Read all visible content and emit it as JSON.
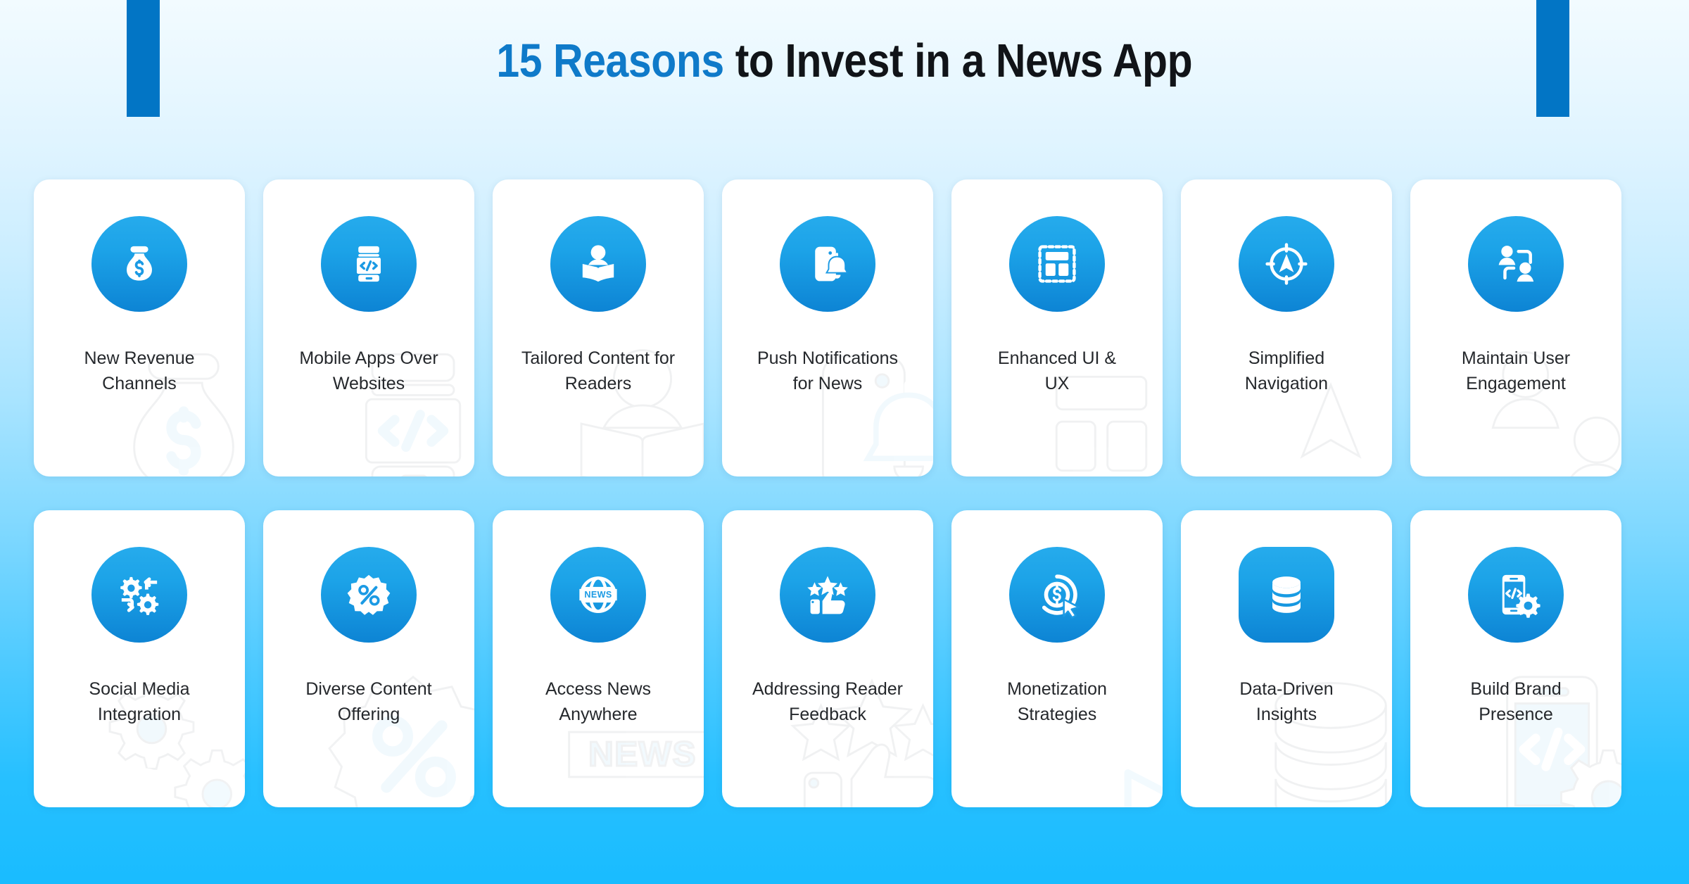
{
  "header": {
    "title_accent": "15 Reasons",
    "title_rest": " to Invest in a News App",
    "accent_color": "#0f7ac9",
    "text_color": "#111418"
  },
  "decor": {
    "bar_color": "#0275c5",
    "left_bar_name": "top-accent-bar-left",
    "right_bar_name": "top-accent-bar-right"
  },
  "theme": {
    "card_background": "#ffffff",
    "badge_gradient_start": "#26abec",
    "badge_gradient_end": "#0d84d4",
    "page_gradient_top": "#f2fbff",
    "page_gradient_bottom": "#19bcff",
    "label_color": "#25282c"
  },
  "cards": [
    {
      "index": 1,
      "label": "New Revenue Channels",
      "line1": "New Revenue",
      "line2": "Channels",
      "icon": "money-bag-icon",
      "shape": "circle"
    },
    {
      "index": 2,
      "label": "Mobile Apps Over Websites",
      "line1": "Mobile Apps Over",
      "line2": "Websites",
      "icon": "mobile-code-icon",
      "shape": "circle"
    },
    {
      "index": 3,
      "label": "Tailored Content for Readers",
      "line1": "Tailored Content for",
      "line2": "Readers",
      "icon": "person-reading-book-icon",
      "shape": "circle"
    },
    {
      "index": 4,
      "label": "Push Notifications for News",
      "line1": "Push Notifications",
      "line2": "for News",
      "icon": "phone-bell-notification-icon",
      "shape": "circle"
    },
    {
      "index": 5,
      "label": "Enhanced UI & UX",
      "line1": "Enhanced UI &",
      "line2": "UX",
      "icon": "wireframe-layout-icon",
      "shape": "circle"
    },
    {
      "index": 6,
      "label": "Simplified Navigation",
      "line1": "Simplified",
      "line2": "Navigation",
      "icon": "compass-navigation-icon",
      "shape": "circle"
    },
    {
      "index": 7,
      "label": "Maintain User Engagement",
      "line1": "Maintain User",
      "line2": "Engagement",
      "icon": "two-users-exchange-icon",
      "shape": "circle"
    },
    {
      "index": 8,
      "label": "Social Media Integration",
      "line1": "Social Media",
      "line2": "Integration",
      "icon": "gears-sync-icon",
      "shape": "circle"
    },
    {
      "index": 9,
      "label": "Diverse Content Offering",
      "line1": "Diverse Content",
      "line2": "Offering",
      "icon": "percent-badge-icon",
      "shape": "circle"
    },
    {
      "index": 10,
      "label": "Access News Anywhere",
      "line1": "Access News",
      "line2": "Anywhere",
      "icon": "globe-news-icon",
      "shape": "circle",
      "icon_text": "NEWS"
    },
    {
      "index": 11,
      "label": "Addressing Reader Feedback",
      "line1": "Addressing Reader",
      "line2": "Feedback",
      "icon": "thumbs-up-stars-icon",
      "shape": "circle"
    },
    {
      "index": 12,
      "label": "Monetization Strategies",
      "line1": "Monetization",
      "line2": "Strategies",
      "icon": "dollar-coin-cursor-icon",
      "shape": "circle"
    },
    {
      "index": 13,
      "label": "Data-Driven Insights",
      "line1": "Data-Driven",
      "line2": "Insights",
      "icon": "database-stack-icon",
      "shape": "squircle"
    },
    {
      "index": 14,
      "label": "Build Brand Presence",
      "line1": "Build Brand",
      "line2": "Presence",
      "icon": "mobile-code-gear-icon",
      "shape": "circle"
    }
  ]
}
